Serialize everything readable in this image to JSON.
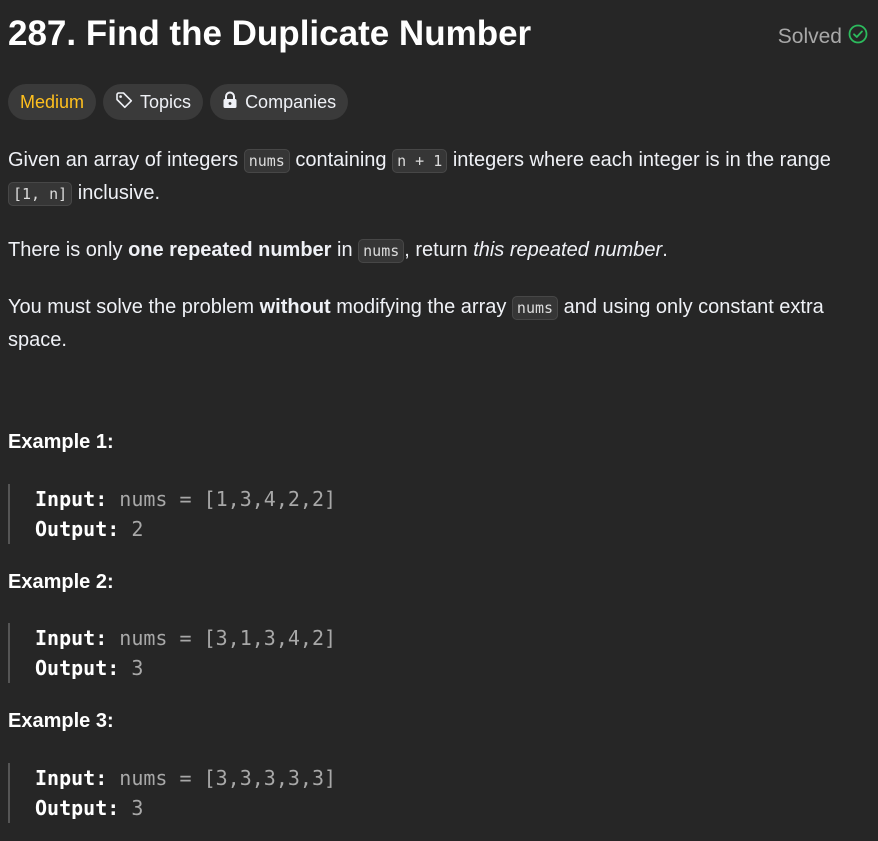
{
  "problem": {
    "title": "287. Find the Duplicate Number",
    "status": "Solved",
    "status_color": "#2cbb5d"
  },
  "tags": {
    "difficulty": "Medium",
    "topics": "Topics",
    "companies": "Companies"
  },
  "description": {
    "p1": {
      "t1": "Given an array of integers ",
      "c1": "nums",
      "t2": " containing ",
      "c2": "n + 1",
      "t3": " integers where each integer is in the range ",
      "c3": "[1, n]",
      "t4": " inclusive."
    },
    "p2": {
      "t1": "There is only ",
      "b1": "one repeated number",
      "t2": " in ",
      "c1": "nums",
      "t3": ", return ",
      "i1": "this repeated number",
      "t4": "."
    },
    "p3": {
      "t1": "You must solve the problem ",
      "b1": "without",
      "t2": " modifying the array ",
      "c1": "nums",
      "t3": " and using only constant extra space."
    }
  },
  "examples": [
    {
      "title": "Example 1:",
      "input_label": "Input:",
      "input": "nums = [1,3,4,2,2]",
      "output_label": "Output:",
      "output": "2"
    },
    {
      "title": "Example 2:",
      "input_label": "Input:",
      "input": "nums = [3,1,3,4,2]",
      "output_label": "Output:",
      "output": "3"
    },
    {
      "title": "Example 3:",
      "input_label": "Input:",
      "input": "nums = [3,3,3,3,3]",
      "output_label": "Output:",
      "output": "3"
    }
  ]
}
